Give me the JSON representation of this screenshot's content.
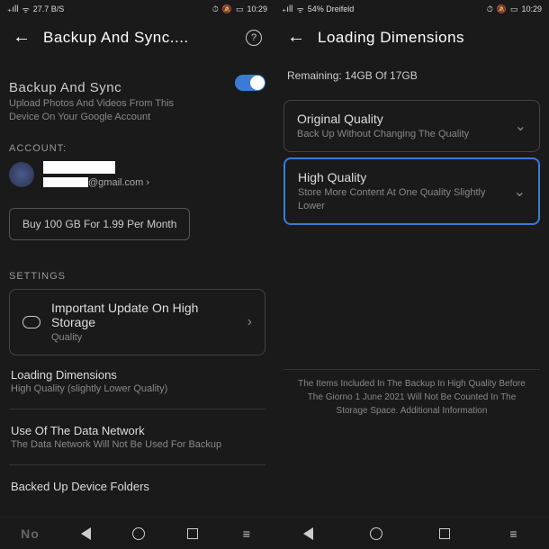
{
  "status": {
    "left1": "27.7 B/S",
    "right_time": "10:29",
    "right_time2": "10:29",
    "carrier2": "54% Dreifeld"
  },
  "screen1": {
    "title": "Backup And Sync....",
    "main": {
      "heading": "Backup And Sync",
      "desc1": "Upload Photos And Videos From This",
      "desc2": "Device On Your Google Account"
    },
    "account_label": "ACCOUNT:",
    "email_suffix": "@gmail.com",
    "buy": "Buy 100 GB For 1.99 Per Month",
    "settings_label": "SETTINGS",
    "card": {
      "title": "Important Update On High Storage",
      "sub": "Quality"
    },
    "dim": {
      "title": "Loading Dimensions",
      "sub": "High Quality (slightly Lower Quality)"
    },
    "net": {
      "title": "Use Of The Data Network",
      "sub": "The Data Network Will Not Be Used For Backup"
    },
    "folders": "Backed Up Device Folders",
    "no": "No"
  },
  "screen2": {
    "title": "Loading Dimensions",
    "remaining": "Remaining: 14GB Of 17GB",
    "opt1": {
      "title": "Original Quality",
      "sub": "Back Up Without Changing The Quality"
    },
    "opt2": {
      "title": "High Quality",
      "sub": "Store More Content At One Quality Slightly Lower"
    },
    "footnote": "The Items Included In The Backup In High Quality Before The Giorno 1 June 2021 Will Not Be Counted In The Storage Space. Additional Information"
  }
}
